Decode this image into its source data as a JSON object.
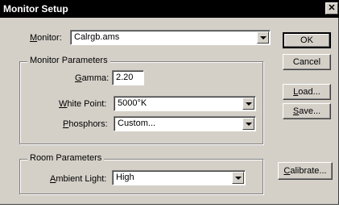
{
  "window": {
    "title": "Monitor Setup",
    "close_glyph": "✕"
  },
  "monitor": {
    "label_prefix": "M",
    "label_rest": "onitor:",
    "value": "Calrgb.ams"
  },
  "monitor_parameters": {
    "title": "Monitor Parameters",
    "gamma": {
      "label_prefix": "G",
      "label_rest": "amma:",
      "value": "2.20"
    },
    "white_point": {
      "label_prefix": "W",
      "label_rest": "hite Point:",
      "value": "5000°K"
    },
    "phosphors": {
      "label_prefix": "P",
      "label_rest": "hosphors:",
      "value": "Custom..."
    }
  },
  "room_parameters": {
    "title": "Room Parameters",
    "ambient_light": {
      "label_prefix": "A",
      "label_rest": "mbient Light:",
      "value": "High"
    }
  },
  "buttons": {
    "ok": "OK",
    "cancel": "Cancel",
    "load_prefix": "L",
    "load_rest": "oad...",
    "save_prefix": "S",
    "save_rest": "ave...",
    "calibrate_prefix": "C",
    "calibrate_rest": "alibrate..."
  }
}
